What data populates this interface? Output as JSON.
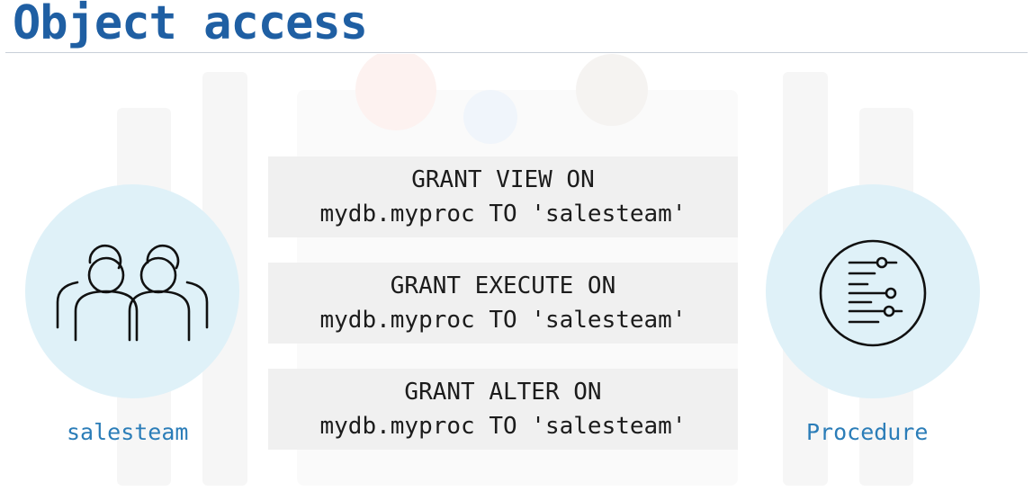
{
  "slide": {
    "title": "Object access"
  },
  "left_entity": {
    "label": "salesteam",
    "icon": "group-of-people-icon"
  },
  "right_entity": {
    "label": "Procedure",
    "icon": "procedure-settings-icon"
  },
  "grants": [
    {
      "line1": "GRANT VIEW ON",
      "line2": "mydb.myproc TO 'salesteam'"
    },
    {
      "line1": "GRANT EXECUTE ON",
      "line2": "mydb.myproc TO 'salesteam'"
    },
    {
      "line1": "GRANT ALTER ON",
      "line2": "mydb.myproc TO 'salesteam'"
    }
  ],
  "colors": {
    "title": "#1f5fa3",
    "caption": "#2b7db8",
    "circle": "#dff1f8",
    "box": "#f0f0f0"
  }
}
